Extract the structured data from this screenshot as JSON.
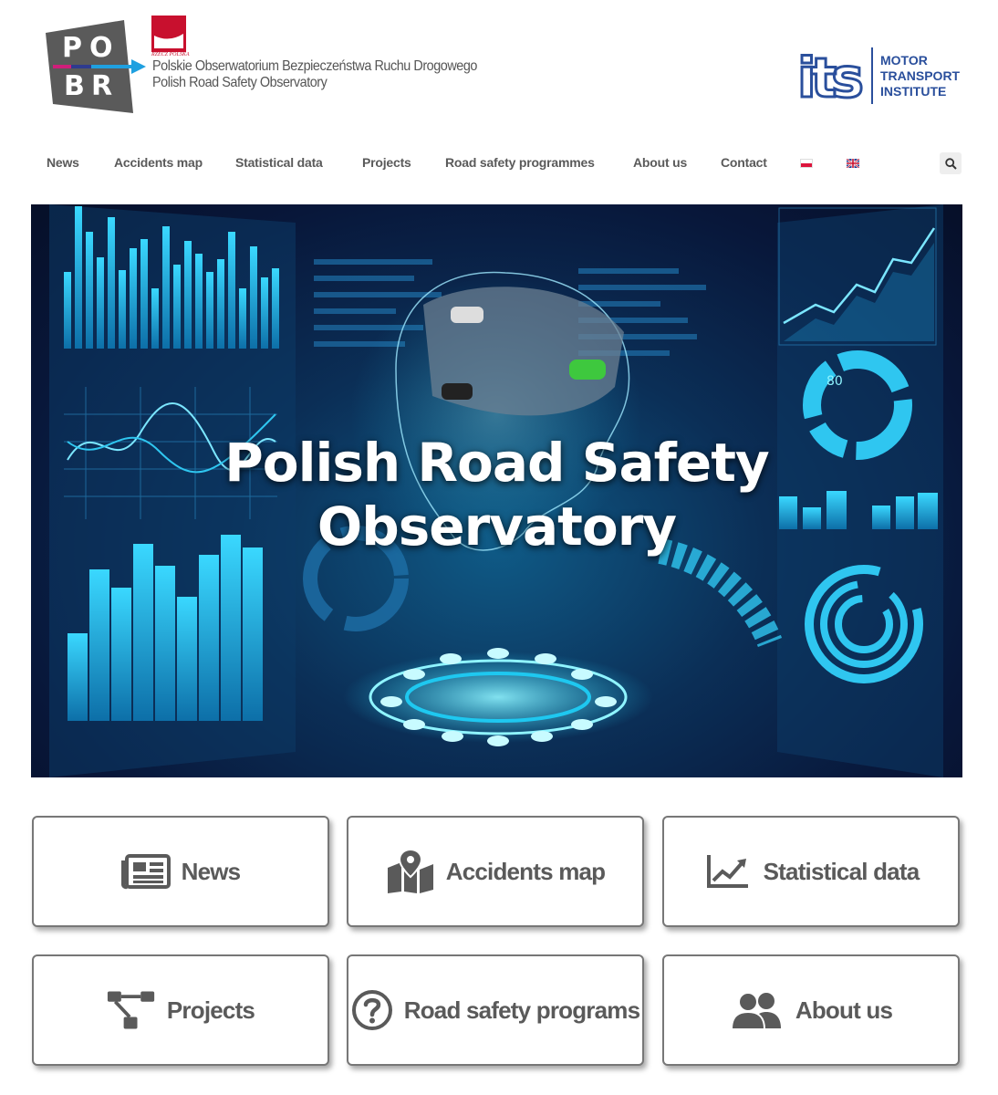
{
  "header": {
    "logo_letters": [
      "PO",
      "BR"
    ],
    "partner_label": "RZECZ POLSKA",
    "org_name_pl": "Polskie Obserwatorium Bezpieczeństwa Ruchu Drogowego",
    "org_name_en": "Polish Road Safety Observatory",
    "its_logo_text": "its",
    "its_lines": [
      "MOTOR",
      "TRANSPORT",
      "INSTITUTE"
    ]
  },
  "nav": {
    "items": [
      {
        "label": "News"
      },
      {
        "label": "Accidents map"
      },
      {
        "label": "Statistical data"
      },
      {
        "label": "Projects"
      },
      {
        "label": "Road safety programmes"
      },
      {
        "label": "About us"
      },
      {
        "label": "Contact"
      }
    ],
    "languages": [
      "pl-flag-icon",
      "gb-flag-icon"
    ],
    "search_icon": "search-icon"
  },
  "hero": {
    "title_line1": "Polish Road Safety",
    "title_line2": "Observatory"
  },
  "tiles": [
    {
      "label": "News",
      "icon": "newspaper-icon"
    },
    {
      "label": "Accidents map",
      "icon": "map-marker-icon"
    },
    {
      "label": "Statistical data",
      "icon": "line-chart-icon"
    },
    {
      "label": "Projects",
      "icon": "sitemap-icon"
    },
    {
      "label": "Road safety programs",
      "icon": "question-circle-icon"
    },
    {
      "label": "About us",
      "icon": "users-icon"
    }
  ],
  "colors": {
    "brand_blue": "#2a4f9c",
    "pobr_gray": "#5a5a5a",
    "pobr_arrow": "#1fa0e0",
    "hero_cyan": "#1ec8f0"
  }
}
